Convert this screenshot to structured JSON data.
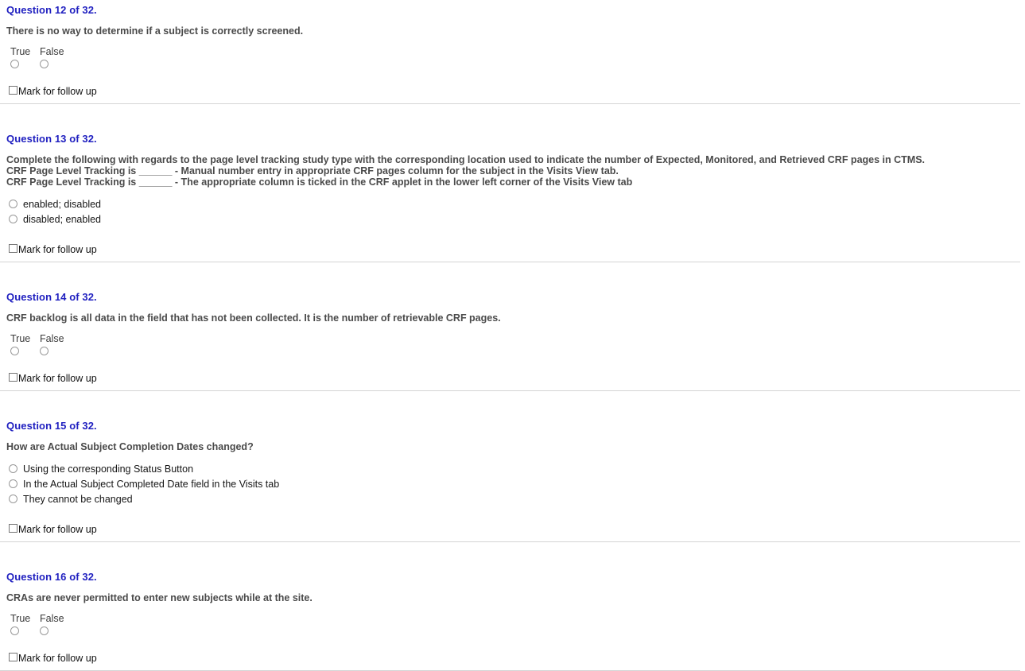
{
  "quiz": {
    "followup_label": "Mark for follow up",
    "heading_color": "#2020C0",
    "divider_color": "#d4d4d4",
    "questions": [
      {
        "heading": "Question 12 of 32.",
        "type": "true-false",
        "lines": [
          "There is no way to determine if a subject is correctly screened."
        ],
        "options": [
          "True",
          "False"
        ]
      },
      {
        "heading": "Question 13 of 32.",
        "type": "multiple-choice",
        "lines": [
          "Complete the following with regards to the page level tracking study type with the corresponding location used to indicate the number of Expected, Monitored, and Retrieved CRF pages in CTMS.",
          "CRF Page Level Tracking is ______ - Manual number entry in appropriate CRF pages column for the subject in the Visits View tab.",
          "CRF Page Level Tracking is ______ - The appropriate column is ticked in the CRF applet in the lower left corner of the Visits View tab"
        ],
        "options": [
          "enabled; disabled",
          "disabled; enabled"
        ]
      },
      {
        "heading": "Question 14 of 32.",
        "type": "true-false",
        "lines": [
          "CRF backlog is all data in the field that has not been collected. It is the number of retrievable CRF pages."
        ],
        "options": [
          "True",
          "False"
        ]
      },
      {
        "heading": "Question 15 of 32.",
        "type": "multiple-choice",
        "lines": [
          "How are Actual Subject Completion Dates changed?"
        ],
        "options": [
          "Using the corresponding Status Button",
          "In the Actual Subject Completed Date field in the Visits tab",
          "They cannot be changed"
        ]
      },
      {
        "heading": "Question 16 of 32.",
        "type": "true-false",
        "lines": [
          "CRAs are never permitted to enter new subjects while at the site."
        ],
        "options": [
          "True",
          "False"
        ]
      }
    ]
  }
}
